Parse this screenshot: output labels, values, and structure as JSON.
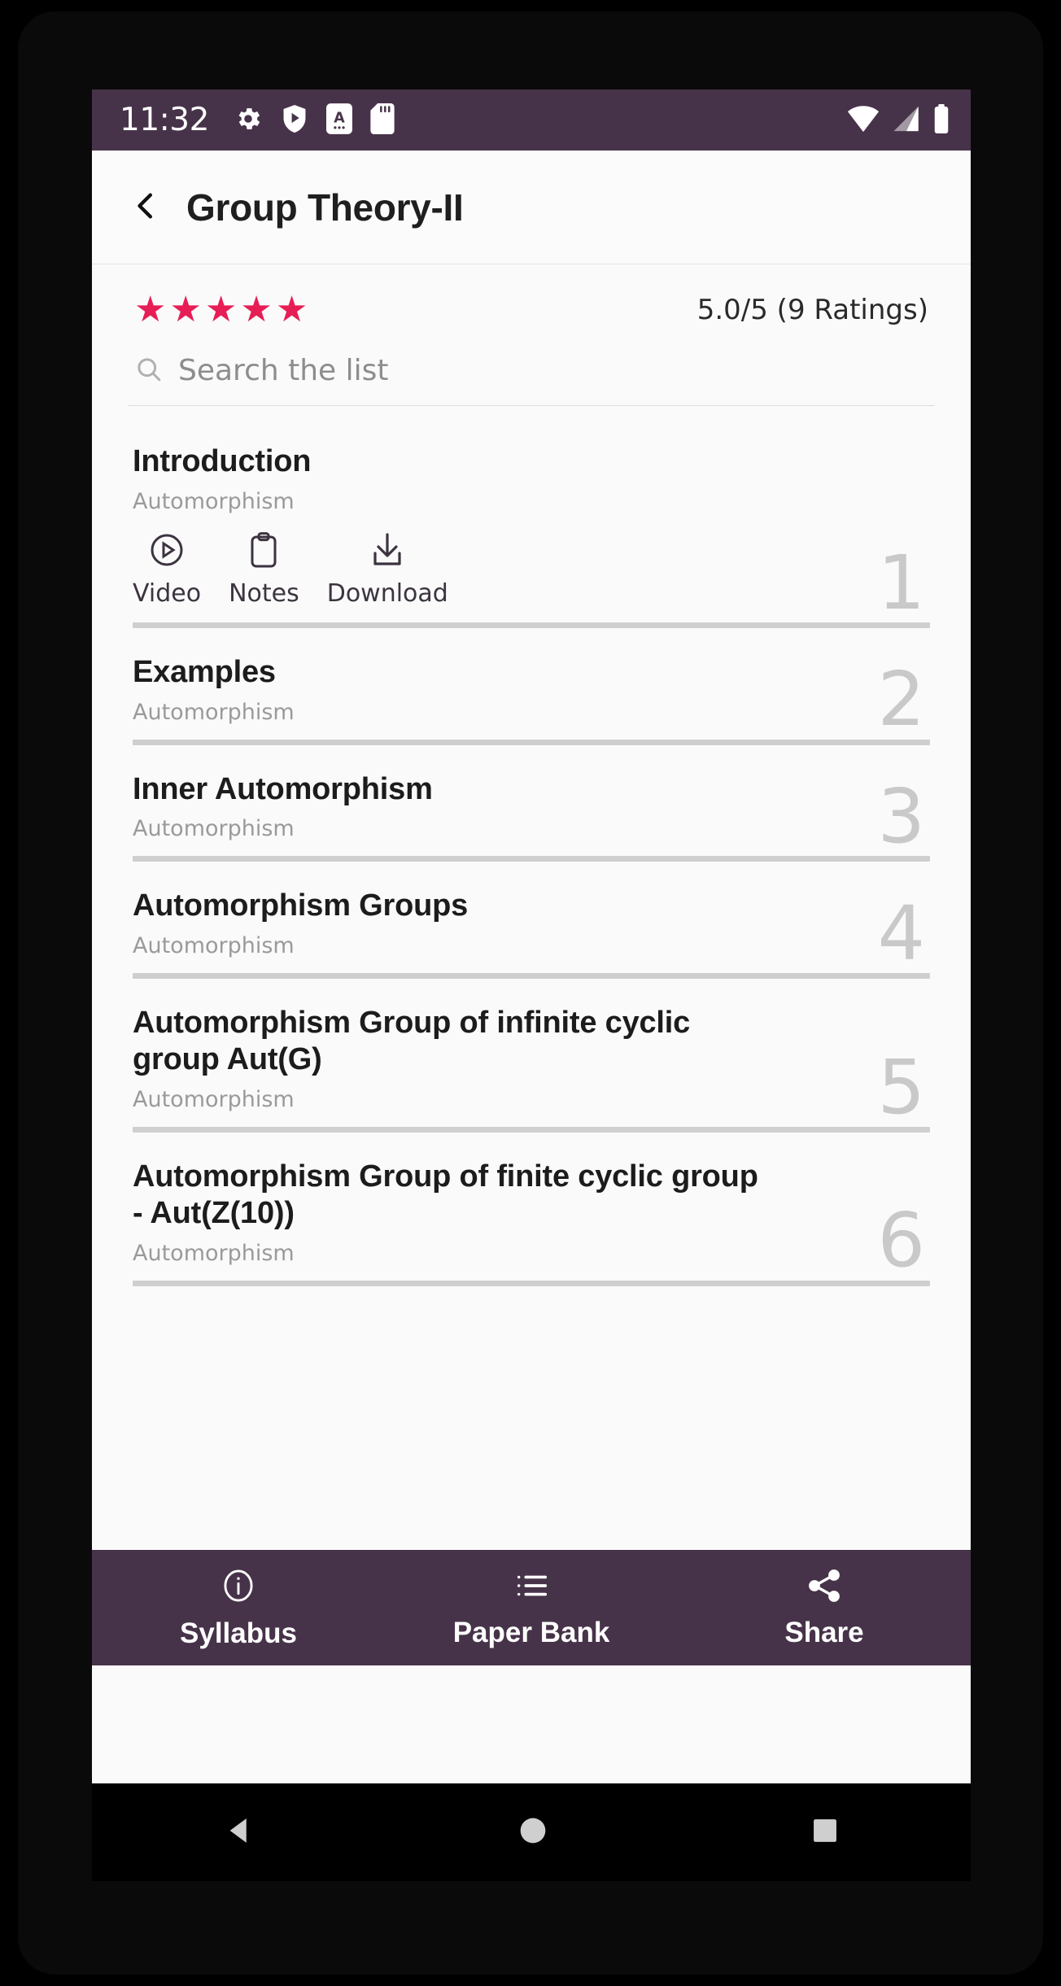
{
  "status_bar": {
    "time": "11:32",
    "left_icons": [
      "gear-icon",
      "shield-play-icon",
      "letter-a-icon",
      "sd-card-icon"
    ],
    "right_icons": [
      "wifi-icon",
      "cellular-signal-icon",
      "battery-icon"
    ],
    "background_color": "#473349"
  },
  "app_bar": {
    "back_icon": "chevron-left-icon",
    "title": "Group Theory-II"
  },
  "rating": {
    "stars_filled": 5,
    "star_glyph": "★",
    "star_color": "#e61e55",
    "text": "5.0/5 (9 Ratings)"
  },
  "search": {
    "icon": "search-icon",
    "placeholder": "Search the list",
    "value": ""
  },
  "list": {
    "items": [
      {
        "title": "Introduction",
        "subtitle": "Automorphism",
        "index": "1",
        "actions": [
          {
            "label": "Video",
            "icon": "play-circle-icon"
          },
          {
            "label": "Notes",
            "icon": "clipboard-icon"
          },
          {
            "label": "Download",
            "icon": "download-icon"
          }
        ]
      },
      {
        "title": "Examples",
        "subtitle": "Automorphism",
        "index": "2",
        "actions": []
      },
      {
        "title": "Inner Automorphism",
        "subtitle": "Automorphism",
        "index": "3",
        "actions": []
      },
      {
        "title": "Automorphism Groups",
        "subtitle": "Automorphism",
        "index": "4",
        "actions": []
      },
      {
        "title": "Automorphism Group of infinite cyclic group Aut(G)",
        "subtitle": "Automorphism",
        "index": "5",
        "actions": []
      },
      {
        "title": "Automorphism Group of finite cyclic group - Aut(Z(10))",
        "subtitle": "Automorphism",
        "index": "6",
        "actions": []
      }
    ]
  },
  "bottom_nav": {
    "background_color": "#473349",
    "items": [
      {
        "label": "Syllabus",
        "icon": "info-circle-icon"
      },
      {
        "label": "Paper Bank",
        "icon": "list-icon"
      },
      {
        "label": "Share",
        "icon": "share-icon"
      }
    ]
  },
  "system_nav": {
    "buttons": [
      {
        "icon": "back-triangle-icon"
      },
      {
        "icon": "home-circle-icon"
      },
      {
        "icon": "recents-square-icon"
      }
    ]
  }
}
